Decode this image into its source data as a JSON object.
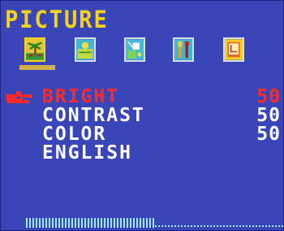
{
  "osd": {
    "title": "PICTURE",
    "tabs": [
      {
        "icon": "palm-tree-icon",
        "selected": true
      },
      {
        "icon": "brightness-icon",
        "selected": false
      },
      {
        "icon": "color-adjust-icon",
        "selected": false
      },
      {
        "icon": "tools-icon",
        "selected": false
      },
      {
        "icon": "position-icon",
        "selected": false
      }
    ],
    "items": [
      {
        "label": "BRIGHT",
        "value": "50",
        "active": true
      },
      {
        "label": "CONTRAST",
        "value": "50",
        "active": false
      },
      {
        "label": "COLOR",
        "value": "50",
        "active": false
      },
      {
        "label": "ENGLISH",
        "value": "",
        "active": false
      }
    ],
    "level_fraction": 0.5,
    "colors": {
      "background": "#3a46b8",
      "title": "#f2d21c",
      "active": "#ff2a2a",
      "text": "#ffffff",
      "bar": "#9fe9ff"
    }
  }
}
